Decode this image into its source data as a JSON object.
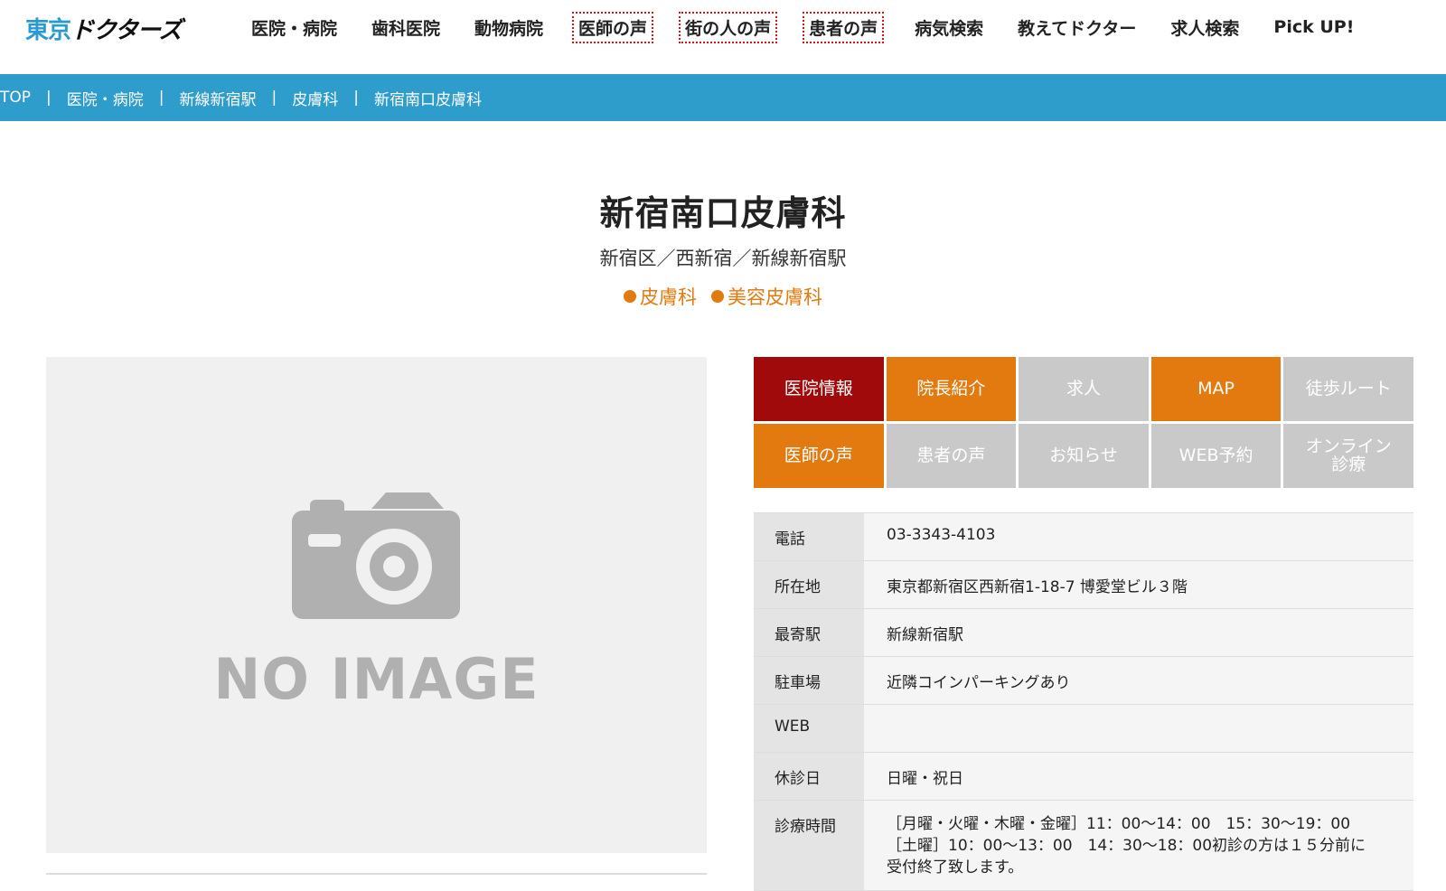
{
  "header": {
    "logo_part1": "東京",
    "logo_part2": "ドクターズ",
    "nav": [
      {
        "label": "医院・病院"
      },
      {
        "label": "歯科医院"
      },
      {
        "label": "動物病院"
      },
      {
        "label": "医師の声"
      },
      {
        "label": "街の人の声"
      },
      {
        "label": "患者の声"
      },
      {
        "label": "病気検索"
      },
      {
        "label": "教えてドクター"
      },
      {
        "label": "求人検索"
      },
      {
        "label": "Pick UP!"
      }
    ]
  },
  "breadcrumb": {
    "items": [
      "TOP",
      "医院・病院",
      "新線新宿駅",
      "皮膚科",
      "新宿南口皮膚科"
    ],
    "separator": "|"
  },
  "clinic": {
    "name": "新宿南口皮膚科",
    "location": "新宿区／西新宿／新線新宿駅",
    "tags": [
      "皮膚科",
      "美容皮膚科"
    ]
  },
  "image": {
    "placeholder_text": "NO IMAGE",
    "icon": "camera-icon"
  },
  "tabs": [
    {
      "label": "医院情報",
      "state": "active"
    },
    {
      "label": "院長紹介",
      "state": "orange"
    },
    {
      "label": "求人",
      "state": "gray"
    },
    {
      "label": "MAP",
      "state": "orange"
    },
    {
      "label": "徒歩ルート",
      "state": "gray"
    },
    {
      "label": "医師の声",
      "state": "orange"
    },
    {
      "label": "患者の声",
      "state": "gray"
    },
    {
      "label": "お知らせ",
      "state": "gray"
    },
    {
      "label": "WEB予約",
      "state": "gray"
    },
    {
      "label": "オンライン\n診療",
      "state": "gray"
    }
  ],
  "info": {
    "phone_label": "電話",
    "phone": "03-3343-4103",
    "address_label": "所在地",
    "address": "東京都新宿区西新宿1-18-7 博愛堂ビル３階",
    "station_label": "最寄駅",
    "station": "新線新宿駅",
    "parking_label": "駐車場",
    "parking": "近隣コインパーキングあり",
    "web_label": "WEB",
    "web": "",
    "closed_label": "休診日",
    "closed": "日曜・祝日",
    "hours_label": "診療時間",
    "hours_line1": "［月曜・火曜・木曜・金曜］11：00〜14：00　15：30〜19：00",
    "hours_line2": "［土曜］10：00〜13：00　14：30〜18：00初診の方は１５分前に",
    "hours_line3": "受付終了致します。"
  },
  "colors": {
    "brand_blue": "#2f9dcc",
    "accent_orange": "#e37a10",
    "active_red": "#a00a0a",
    "inactive_gray": "#c9c9c9"
  }
}
